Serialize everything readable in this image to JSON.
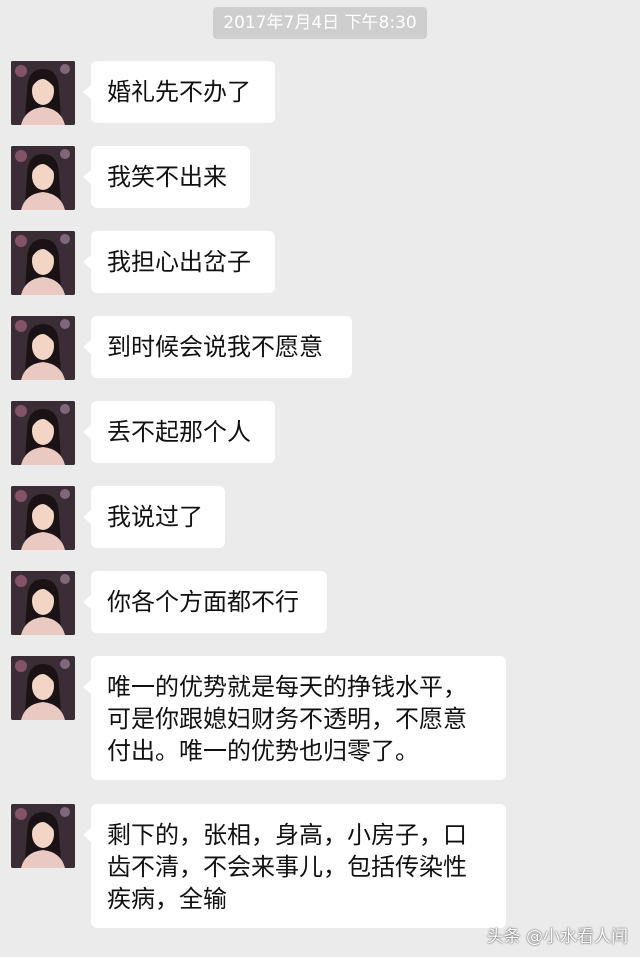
{
  "chat": {
    "timestamp": "2017年7月4日 下午8:30",
    "messages": [
      {
        "text": "婚礼先不办了"
      },
      {
        "text": "我笑不出来"
      },
      {
        "text": "我担心出岔子"
      },
      {
        "text": "到时候会说我不愿意"
      },
      {
        "text": "丢不起那个人"
      },
      {
        "text": "我说过了"
      },
      {
        "text": "你各个方面都不行"
      },
      {
        "text": "唯一的优势就是每天的挣钱水平，可是你跟媳妇财务不透明，不愿意付出。唯一的优势也归零了。"
      },
      {
        "text": "剩下的，张相，身高，小房子，口齿不清，不会来事儿，包括传染性疾病，全输"
      }
    ]
  },
  "watermark": "头条 @小水看人间",
  "colors": {
    "background": "#ebebeb",
    "bubble": "#ffffff",
    "timestamp_bg": "#cecece",
    "text": "#111111"
  }
}
